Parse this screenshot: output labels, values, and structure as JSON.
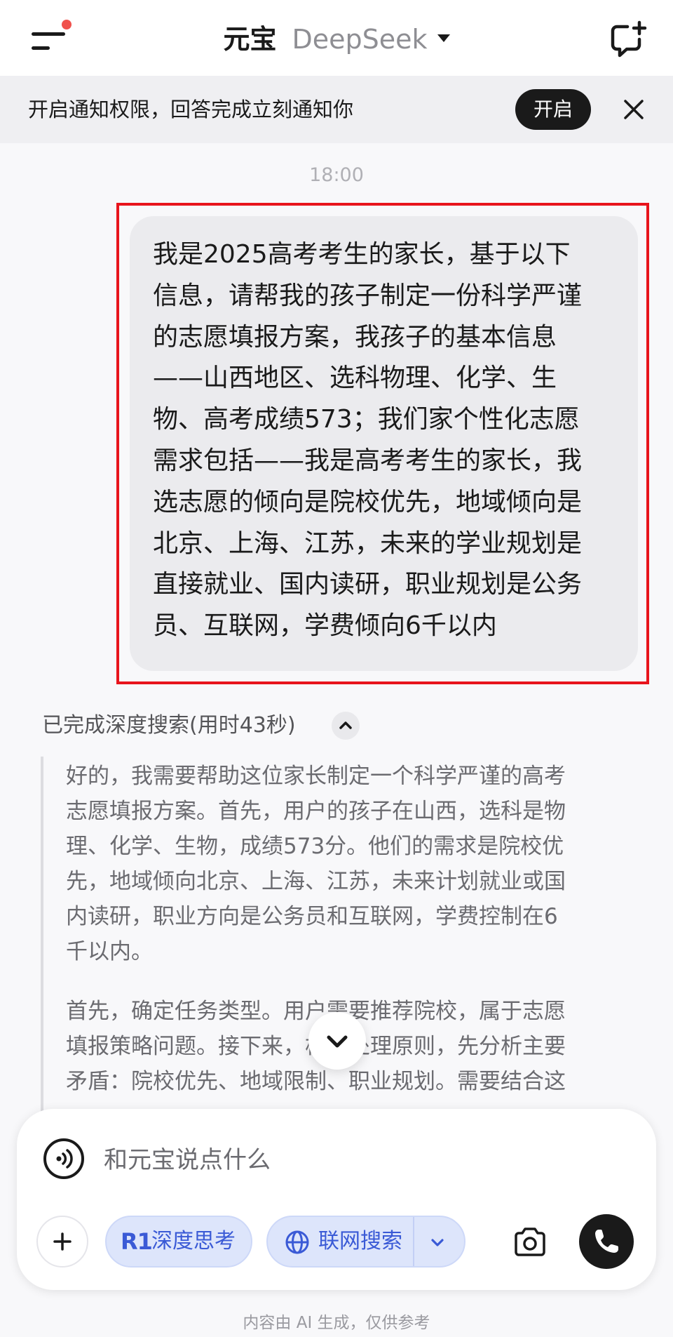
{
  "header": {
    "app_name": "元宝",
    "model_name": "DeepSeek"
  },
  "notification": {
    "text": "开启通知权限，回答完成立刻通知你",
    "open_label": "开启"
  },
  "chat": {
    "timestamp": "18:00",
    "user_message": [
      "我是2025高考考生的家长，基于以下",
      "信息，请帮我的孩子制定一份科学严谨",
      "的志愿填报方案，我孩子的基本信息",
      "——山西地区、选科物理、化学、生",
      "物、高考成绩573；我们家个性化志愿",
      "需求包括——我是高考考生的家长，我",
      "选志愿的倾向是院校优先，地域倾向是",
      "北京、上海、江苏，未来的学业规划是",
      "直接就业、国内读研，职业规划是公务",
      "员、互联网，学费倾向6千以内"
    ],
    "search_status": "已完成深度搜索(用时43秒)",
    "thinking_para1": [
      "好的，我需要帮助这位家长制定一个科学严谨的高考",
      "志愿填报方案。首先，用户的孩子在山西，选科是物",
      "理、化学、生物，成绩573分。他们的需求是院校优",
      "先，地域倾向北京、上海、江苏，未来计划就业或国",
      "内读研，职业方向是公务员和互联网，学费控制在6",
      "千以内。"
    ],
    "thinking_para2": [
      "首先，确定任务类型。用户需要推荐院校，属于志愿",
      "填报策略问题。接下来，根据处理原则，先分析主要",
      "矛盾：院校优先、地域限制、职业规划。需要结合这"
    ]
  },
  "composer": {
    "placeholder": "和元宝说点什么",
    "deep_think_badge": "R1",
    "deep_think_label": "深度思考",
    "web_search_label": "联网搜索"
  },
  "footer": {
    "disclaimer": "内容由 AI 生成，仅供参考"
  },
  "colors": {
    "accent_blue": "#3a5ad6",
    "highlight_red": "#e8141c",
    "notification_dot": "#f0514c"
  }
}
